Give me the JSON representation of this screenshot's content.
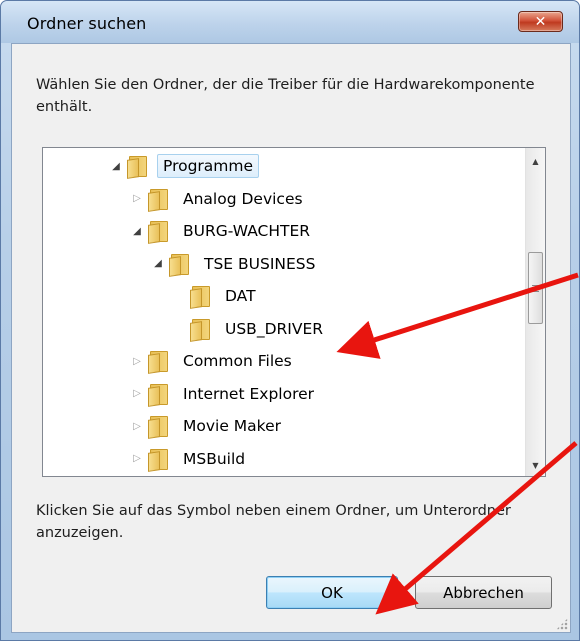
{
  "dialog": {
    "title": "Ordner suchen",
    "close_symbol": "✕",
    "description": "Wählen Sie den Ordner, der die Treiber für die Hardwarekomponente enthält.",
    "hint": "Klicken Sie auf das Symbol neben einem Ordner, um Unterordner anzuzeigen.",
    "ok_label": "OK",
    "cancel_label": "Abbrechen"
  },
  "tree": {
    "items": [
      {
        "label": "Programme",
        "level": 0,
        "state": "expanded",
        "selected": true
      },
      {
        "label": "Analog Devices",
        "level": 1,
        "state": "collapsed",
        "selected": false
      },
      {
        "label": "BURG-WACHTER",
        "level": 1,
        "state": "expanded",
        "selected": false
      },
      {
        "label": "TSE BUSINESS",
        "level": 2,
        "state": "expanded",
        "selected": false
      },
      {
        "label": "DAT",
        "level": 3,
        "state": "leaf",
        "selected": false
      },
      {
        "label": "USB_DRIVER",
        "level": 3,
        "state": "leaf",
        "selected": false
      },
      {
        "label": "Common Files",
        "level": 1,
        "state": "collapsed",
        "selected": false
      },
      {
        "label": "Internet Explorer",
        "level": 1,
        "state": "collapsed",
        "selected": false
      },
      {
        "label": "Movie Maker",
        "level": 1,
        "state": "collapsed",
        "selected": false
      },
      {
        "label": "MSBuild",
        "level": 1,
        "state": "collapsed",
        "selected": false
      }
    ]
  },
  "colors": {
    "annotation_arrow": "#e8150f",
    "title_bar": "#bdd3eb",
    "close_button": "#d2533a"
  }
}
